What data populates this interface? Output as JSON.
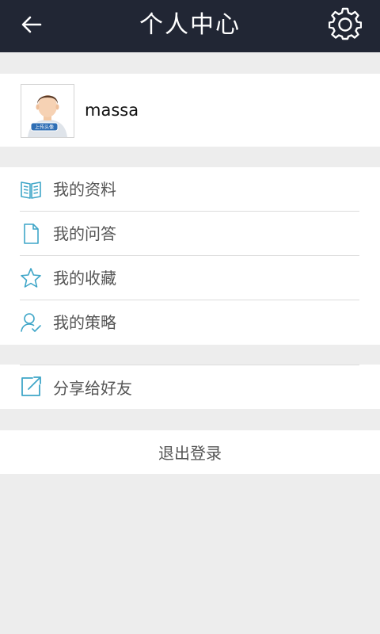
{
  "colors": {
    "topbar_bg": "#212634",
    "page_bg": "#ededed",
    "icon_accent": "#3fa6c8",
    "text_primary": "#111111",
    "text_menu": "#555555"
  },
  "header": {
    "title": "个人中心",
    "back_icon": "arrow-left-icon",
    "settings_icon": "gear-icon"
  },
  "profile": {
    "username": "massa",
    "avatar_badge": "上传头像"
  },
  "menu": {
    "items": [
      {
        "label": "我的资料",
        "icon": "open-book-icon"
      },
      {
        "label": "我的问答",
        "icon": "document-icon"
      },
      {
        "label": "我的收藏",
        "icon": "star-icon"
      },
      {
        "label": "我的策略",
        "icon": "user-check-icon"
      }
    ]
  },
  "share": {
    "label": "分享给好友",
    "icon": "share-external-icon"
  },
  "logout": {
    "label": "退出登录"
  }
}
